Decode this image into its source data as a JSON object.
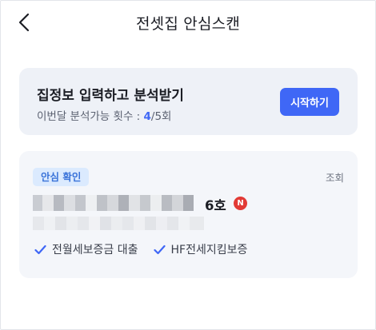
{
  "header": {
    "title": "전셋집 안심스캔"
  },
  "promo": {
    "headline": "집정보 입력하고 분석받기",
    "quota_label": "이번달 분석가능 횟수 : ",
    "quota_used": "4",
    "quota_total": "/5회",
    "start_button": "시작하기"
  },
  "card": {
    "badge": "안심 확인",
    "views_label": "조회",
    "address_suffix": "6호",
    "new_badge": "N",
    "features": [
      {
        "icon": "check-icon",
        "label": "전월세보증금 대출"
      },
      {
        "icon": "check-icon",
        "label": "HF전세지킴보증"
      }
    ]
  },
  "colors": {
    "accent": "#3f67f6",
    "badge_bg": "#dbeafe",
    "badge_text": "#3a73d9",
    "new_badge": "#e23a35",
    "card_bg": "#f4f6fa",
    "promo_bg": "#eef1f7"
  }
}
